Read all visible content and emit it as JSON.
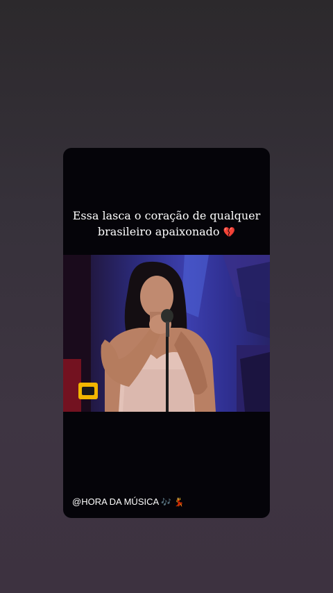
{
  "story": {
    "caption_line1": "Essa lasca o coração de qualquer",
    "caption_line2": "brasileiro apaixonado",
    "caption_emoji": "💔",
    "handle": "@HORA DA MÚSICA",
    "handle_emoji": "🎶 💃"
  },
  "video": {
    "subject": "singer-performing-with-microphone",
    "badge_icon": "tv-channel-logo-icon"
  },
  "colors": {
    "background": "#36313a",
    "card": "#050409",
    "stage_blue": "#3c3fae",
    "badge_yellow": "#f2b600",
    "heart_red": "#d0213f"
  }
}
